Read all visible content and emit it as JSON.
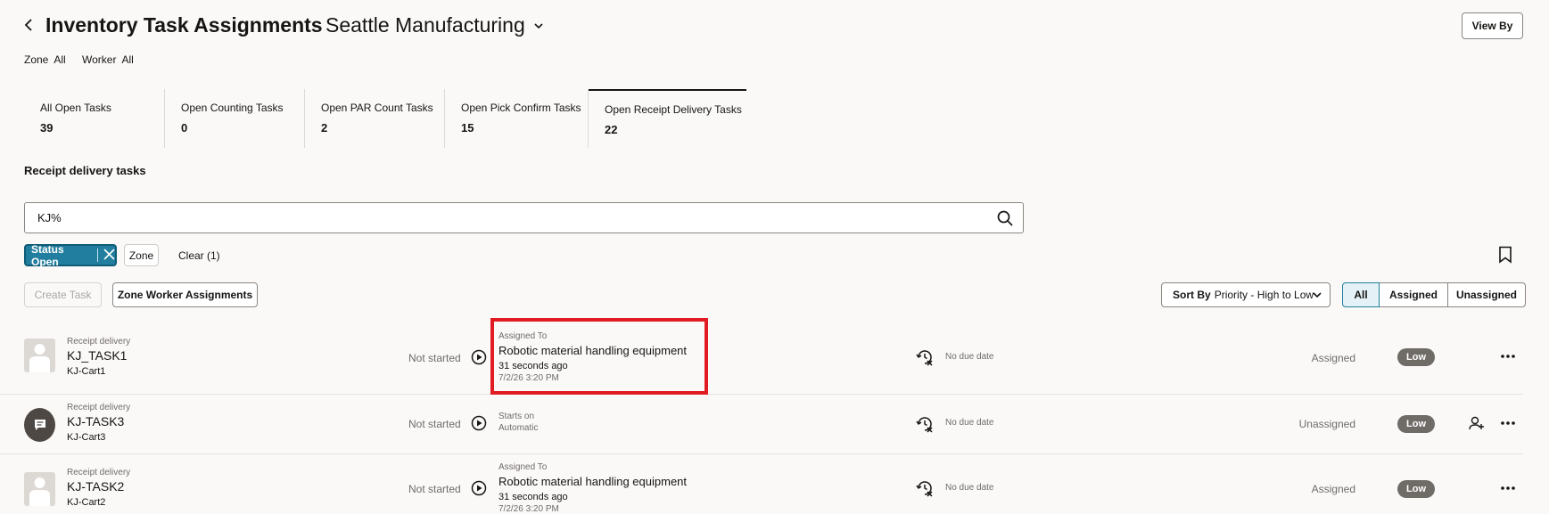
{
  "header": {
    "title": "Inventory Task Assignments",
    "site": "Seattle Manufacturing",
    "view_by_label": "View By"
  },
  "filters": {
    "zone_label": "Zone",
    "zone_value": "All",
    "worker_label": "Worker",
    "worker_value": "All"
  },
  "tiles": [
    {
      "label": "All Open Tasks",
      "count": "39"
    },
    {
      "label": "Open Counting Tasks",
      "count": "0"
    },
    {
      "label": "Open PAR Count Tasks",
      "count": "2"
    },
    {
      "label": "Open Pick Confirm Tasks",
      "count": "15"
    },
    {
      "label": "Open Receipt Delivery Tasks",
      "count": "22"
    }
  ],
  "section_title": "Receipt delivery tasks",
  "search": {
    "value": "KJ%"
  },
  "chips": {
    "status": "Status Open",
    "zone": "Zone",
    "clear": "Clear (1)"
  },
  "toolbar": {
    "create_task": "Create Task",
    "zone_worker": "Zone Worker Assignments",
    "sort_label": "Sort By",
    "sort_value": "Priority - High to Low",
    "seg_all": "All",
    "seg_assigned": "Assigned",
    "seg_unassigned": "Unassigned"
  },
  "rows": [
    {
      "type": "Receipt delivery",
      "name": "KJ_TASK1",
      "cart": "KJ-Cart1",
      "status": "Not started",
      "mid_label": "Assigned To",
      "mid_value": "Robotic material handling equipment",
      "mid_time": "31 seconds ago",
      "mid_date": "7/2/26 3:20 PM",
      "due": "No due date",
      "assignment": "Assigned",
      "priority": "Low"
    },
    {
      "type": "Receipt delivery",
      "name": "KJ-TASK3",
      "cart": "KJ-Cart3",
      "status": "Not started",
      "mid_label": "Starts on",
      "mid_value": "Automatic",
      "due": "No due date",
      "assignment": "Unassigned",
      "priority": "Low"
    },
    {
      "type": "Receipt delivery",
      "name": "KJ-TASK2",
      "cart": "KJ-Cart2",
      "status": "Not started",
      "mid_label": "Assigned To",
      "mid_value": "Robotic material handling equipment",
      "mid_time": "31 seconds ago",
      "mid_date": "7/2/26 3:20 PM",
      "due": "No due date",
      "assignment": "Assigned",
      "priority": "Low"
    }
  ]
}
